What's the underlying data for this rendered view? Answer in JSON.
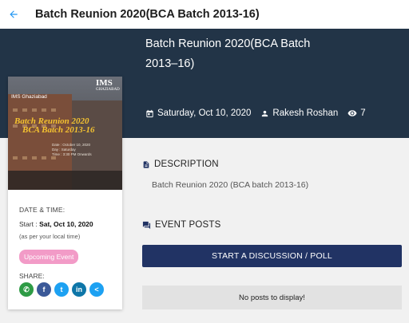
{
  "appbar": {
    "title": "Batch Reunion 2020(BCA Batch 2013-16)",
    "back_icon": "arrow-back-icon"
  },
  "colors": {
    "hero_bg": "#223447",
    "accent_blue": "#2196f3",
    "button_navy": "#213364",
    "badge_pink": "#f29bc7"
  },
  "event": {
    "title": "Batch Reunion 2020(BCA Batch 2013–16)",
    "date": "Saturday, Oct 10, 2020",
    "author": "Rakesh Roshan",
    "views": "7"
  },
  "poster": {
    "logo": "IMS",
    "logo_sub": "GHAZIABAD",
    "campus": "IMS Ghaziabad",
    "title_line1": "Batch Reunion 2020",
    "title_line2": "BCA Batch 2013-16",
    "details": {
      "date_label": "Date",
      "date_value": ": October 10, 2020",
      "day_label": "Day",
      "day_value": ": Saturday",
      "time_label": "Time",
      "time_value": ": 3:30 PM Onwards"
    }
  },
  "card": {
    "datetime_label": "DATE & TIME:",
    "start_label": "Start :",
    "start_value": "Sat, Oct 10, 2020",
    "timezone_note": "(as per your local time)",
    "status_badge": "Upcoming Event",
    "share_label": "SHARE:",
    "share": [
      {
        "name": "whatsapp-icon",
        "glyph": "✆",
        "color": "#2e9b45"
      },
      {
        "name": "facebook-icon",
        "glyph": "f",
        "color": "#3b5998"
      },
      {
        "name": "twitter-icon",
        "glyph": "t",
        "color": "#1da1f2"
      },
      {
        "name": "linkedin-icon",
        "glyph": "in",
        "color": "#0e76a8"
      },
      {
        "name": "share-icon",
        "glyph": "<",
        "color": "#1da1f2"
      }
    ]
  },
  "description": {
    "heading": "DESCRIPTION",
    "text": "Batch Reunion 2020 (BCA batch 2013-16)"
  },
  "posts": {
    "heading": "EVENT POSTS",
    "button_label": "START A DISCUSSION / POLL",
    "empty_text": "No posts to display!"
  }
}
